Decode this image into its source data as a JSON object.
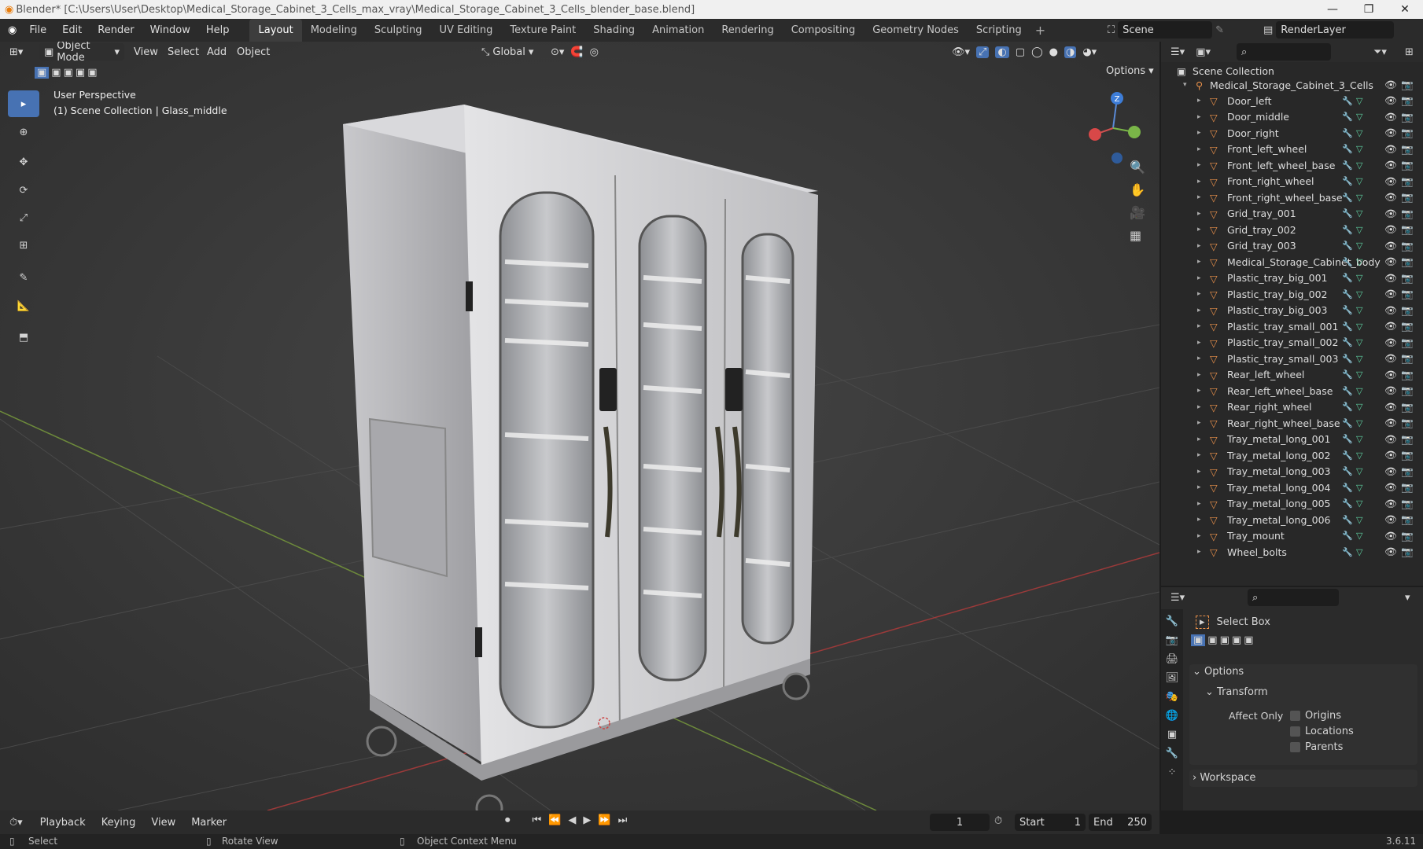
{
  "titlebar": {
    "title": "Blender* [C:\\Users\\User\\Desktop\\Medical_Storage_Cabinet_3_Cells_max_vray\\Medical_Storage_Cabinet_3_Cells_blender_base.blend]"
  },
  "menus": [
    "File",
    "Edit",
    "Render",
    "Window",
    "Help"
  ],
  "workspaces": [
    "Layout",
    "Modeling",
    "Sculpting",
    "UV Editing",
    "Texture Paint",
    "Shading",
    "Animation",
    "Rendering",
    "Compositing",
    "Geometry Nodes",
    "Scripting"
  ],
  "active_workspace": "Layout",
  "scene": {
    "name": "Scene",
    "render_layer": "RenderLayer"
  },
  "viewport_header": {
    "mode": "Object Mode",
    "menus": [
      "View",
      "Select",
      "Add",
      "Object"
    ],
    "orientation": "Global",
    "options": "Options"
  },
  "viewport": {
    "perspective": "User Perspective",
    "collection_info": "(1) Scene Collection | Glass_middle",
    "gizmo_axis": "Z"
  },
  "outliner": {
    "root": "Scene Collection",
    "collection": "Medical_Storage_Cabinet_3_Cells",
    "items": [
      "Door_left",
      "Door_middle",
      "Door_right",
      "Front_left_wheel",
      "Front_left_wheel_base",
      "Front_right_wheel",
      "Front_right_wheel_base",
      "Grid_tray_001",
      "Grid_tray_002",
      "Grid_tray_003",
      "Medical_Storage_Cabinet_body",
      "Plastic_tray_big_001",
      "Plastic_tray_big_002",
      "Plastic_tray_big_003",
      "Plastic_tray_small_001",
      "Plastic_tray_small_002",
      "Plastic_tray_small_003",
      "Rear_left_wheel",
      "Rear_left_wheel_base",
      "Rear_right_wheel",
      "Rear_right_wheel_base",
      "Tray_metal_long_001",
      "Tray_metal_long_002",
      "Tray_metal_long_003",
      "Tray_metal_long_004",
      "Tray_metal_long_005",
      "Tray_metal_long_006",
      "Tray_mount",
      "Wheel_bolts"
    ]
  },
  "properties": {
    "tool_name": "Select Box",
    "options_label": "Options",
    "transform_label": "Transform",
    "affect_only_label": "Affect Only",
    "affect_only": [
      "Origins",
      "Locations",
      "Parents"
    ],
    "workspace_label": "Workspace"
  },
  "timeline": {
    "menus": [
      "Playback",
      "Keying",
      "View",
      "Marker"
    ],
    "current_frame": "1",
    "start_label": "Start",
    "start": "1",
    "end_label": "End",
    "end": "250"
  },
  "statusbar": {
    "select": "Select",
    "rotate": "Rotate View",
    "context": "Object Context Menu",
    "version": "3.6.11"
  },
  "colors": {
    "accent": "#4772b3",
    "object_icon": "#e8904a",
    "modifier_icon": "#6d9fe0",
    "mesh_icon": "#5fd3a3"
  }
}
